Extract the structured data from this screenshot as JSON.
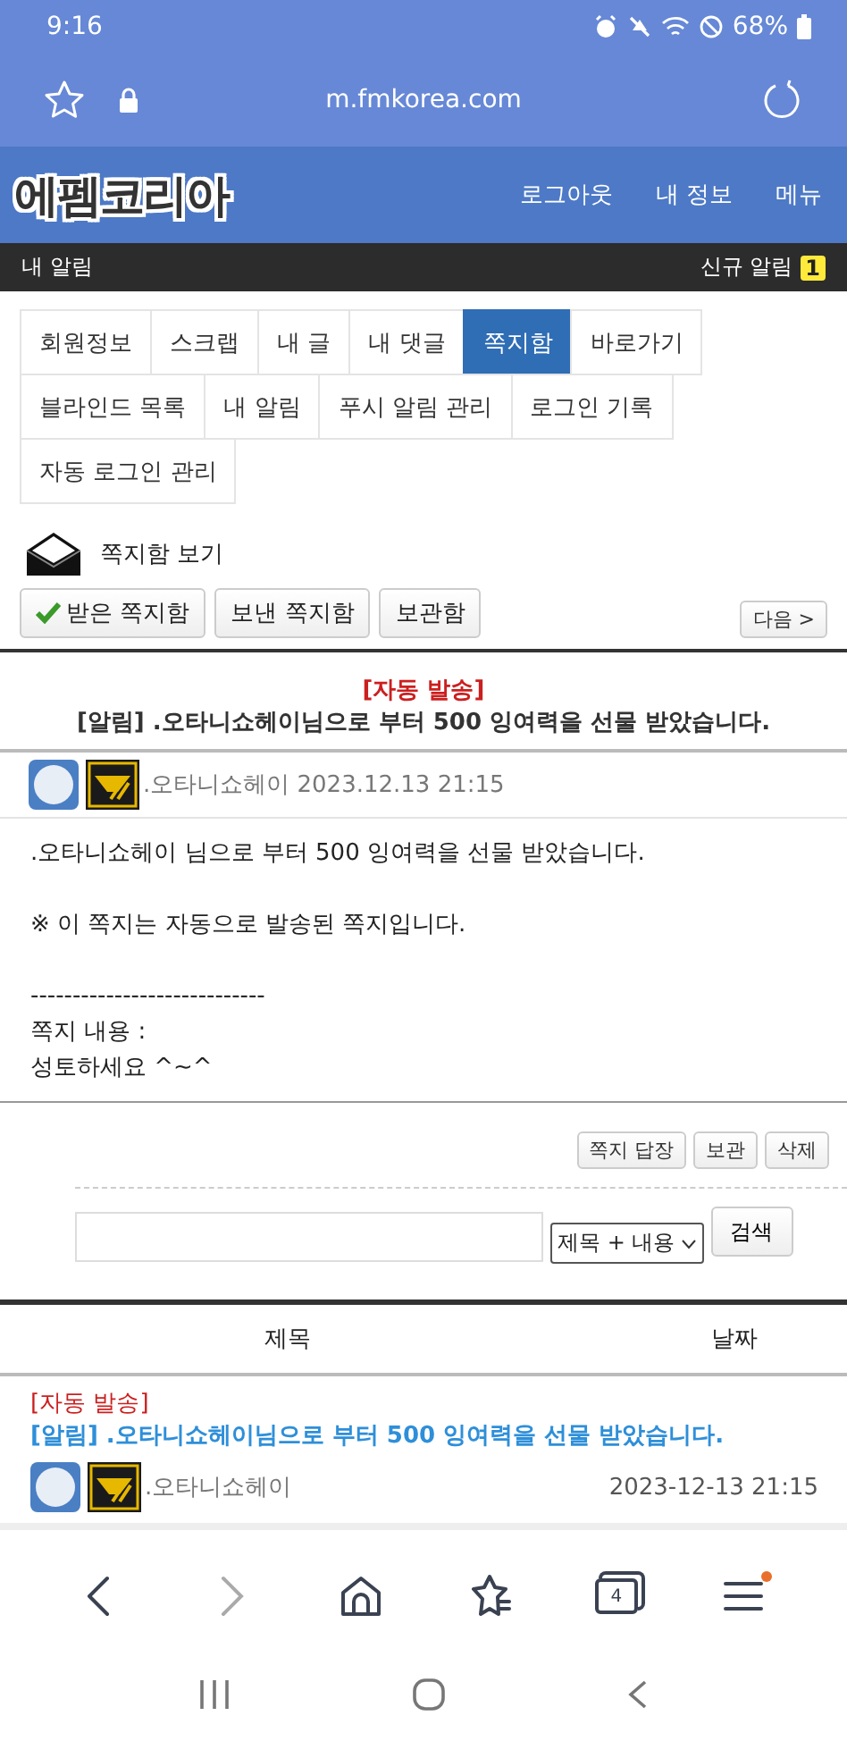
{
  "status_bar": {
    "time": "9:16",
    "battery": "68%"
  },
  "browser": {
    "url": "m.fmkorea.com"
  },
  "site_header": {
    "logo": "에펨코리아",
    "nav": [
      "로그아웃",
      "내 정보",
      "메뉴"
    ]
  },
  "notice_bar": {
    "title": "내 알림",
    "new_label": "신규 알림",
    "count": "1"
  },
  "tabs": [
    {
      "label": "회원정보",
      "selected": false
    },
    {
      "label": "스크랩",
      "selected": false
    },
    {
      "label": "내 글",
      "selected": false
    },
    {
      "label": "내 댓글",
      "selected": false
    },
    {
      "label": "쪽지함",
      "selected": true
    },
    {
      "label": "바로가기",
      "selected": false
    },
    {
      "label": "블라인드 목록",
      "selected": false
    },
    {
      "label": "내 알림",
      "selected": false
    },
    {
      "label": "푸시 알림 관리",
      "selected": false
    },
    {
      "label": "로그인 기록",
      "selected": false
    },
    {
      "label": "자동 로그인 관리",
      "selected": false
    }
  ],
  "mailbox": {
    "title": "쪽지함 보기",
    "folders": [
      {
        "label": "받은 쪽지함",
        "selected": true
      },
      {
        "label": "보낸 쪽지함",
        "selected": false
      },
      {
        "label": "보관함",
        "selected": false
      }
    ],
    "next": "다음 >"
  },
  "message": {
    "tag": "[자동 발송]",
    "subject": "[알림] .오타니쇼헤이님으로 부터 500 잉여력을 선물 받았습니다.",
    "author": ".오타니쇼헤이",
    "date": "2023.12.13 21:15",
    "body": [
      [
        ".오타니쇼헤이 님으로 부터 500 잉여력을 선물 받았습니다."
      ],
      [
        "※ 이 쪽지는 자동으로 발송된 쪽지입니다."
      ],
      [
        "----------------------------",
        "쪽지 내용 :",
        "성토하세요 ^~^"
      ]
    ]
  },
  "actions": [
    "쪽지 답장",
    "보관",
    "삭제"
  ],
  "search": {
    "scope": "제목 + 내용",
    "button": "검색"
  },
  "list": {
    "columns": [
      "제목",
      "날짜"
    ],
    "rows": [
      {
        "tag": "[자동 발송]",
        "subject": "[알림] .오타니쇼헤이님으로 부터 500 잉여력을 선물 받았습니다.",
        "author": ".오타니쇼헤이",
        "date": "2023-12-13 21:15"
      }
    ]
  },
  "bottom_nav": {
    "tab_count": "4"
  }
}
